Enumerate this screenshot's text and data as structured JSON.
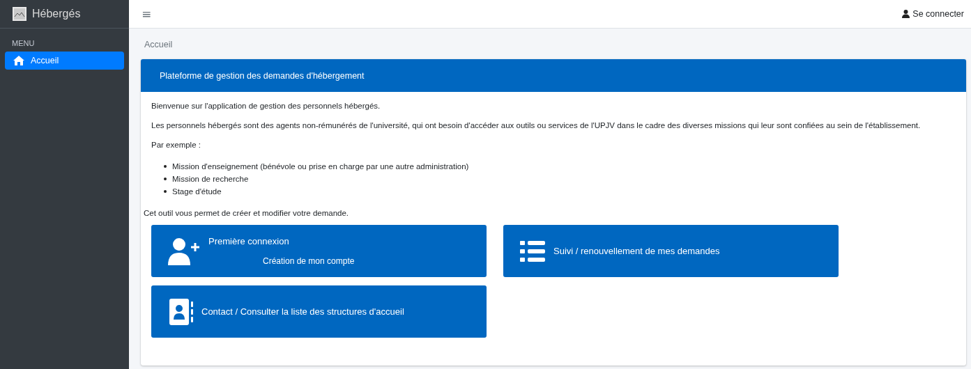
{
  "sidebar": {
    "brand": "Hébergés",
    "section": "MENU",
    "items": [
      {
        "label": "Accueil",
        "selected": true
      }
    ]
  },
  "topbar": {
    "menu_glyph": "≡",
    "login": "Se connecter"
  },
  "breadcrumb": "Accueil",
  "card": {
    "title": "Plateforme de gestion des demandes d'hébergement",
    "paragraphs": [
      "Bienvenue sur l'application de gestion des personnels hébergés.",
      "Les personnels hébergés sont des agents non-rémunérés de l'université, qui ont besoin d'accéder aux outils ou services de l'UPJV dans le cadre des diverses missions qui leur sont confiées au sein de l'établissement.",
      "Par exemple :"
    ],
    "bullets": [
      "Mission d'enseignement (bénévole ou prise en charge par une autre administration)",
      "Mission de recherche",
      "Stage d'étude"
    ],
    "footer": "Cet outil vous permet de créer et modifier votre demande.",
    "tiles": [
      {
        "kind": "user-plus",
        "title": "Première connexion",
        "subtitle": "Création de mon compte"
      },
      {
        "kind": "list",
        "title": "Suivi / renouvellement de mes demandes"
      },
      {
        "kind": "contact",
        "title": "Contact / Consulter la liste des structures d'accueil"
      }
    ]
  }
}
